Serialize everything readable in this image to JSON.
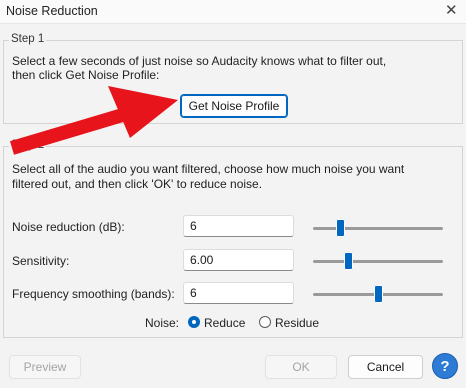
{
  "window": {
    "title": "Noise Reduction",
    "close_glyph": "✕"
  },
  "step1": {
    "heading": "Step 1",
    "line1": "Select a few seconds of just noise so Audacity knows what to filter out,",
    "line2": "then click Get Noise Profile:",
    "button_label": "Get Noise Profile"
  },
  "step2": {
    "heading": "Step 2",
    "line1": "Select all of the audio you want filtered, choose how much noise you want",
    "line2": "filtered out, and then click 'OK' to reduce noise.",
    "noise_reduction": {
      "label": "Noise reduction (dB):",
      "value": "6",
      "slider_fraction": 0.19
    },
    "sensitivity": {
      "label": "Sensitivity:",
      "value": "6.00",
      "slider_fraction": 0.26
    },
    "frequency_smoothing": {
      "label": "Frequency smoothing (bands):",
      "value": "6",
      "slider_fraction": 0.5
    },
    "noise": {
      "label": "Noise:",
      "options": [
        "Reduce",
        "Residue"
      ],
      "selected": "Reduce"
    }
  },
  "buttons": {
    "preview": "Preview",
    "ok": "OK",
    "cancel": "Cancel",
    "help": "?"
  },
  "colors": {
    "accent": "#0067c0",
    "annotation_arrow": "#e8141c"
  }
}
